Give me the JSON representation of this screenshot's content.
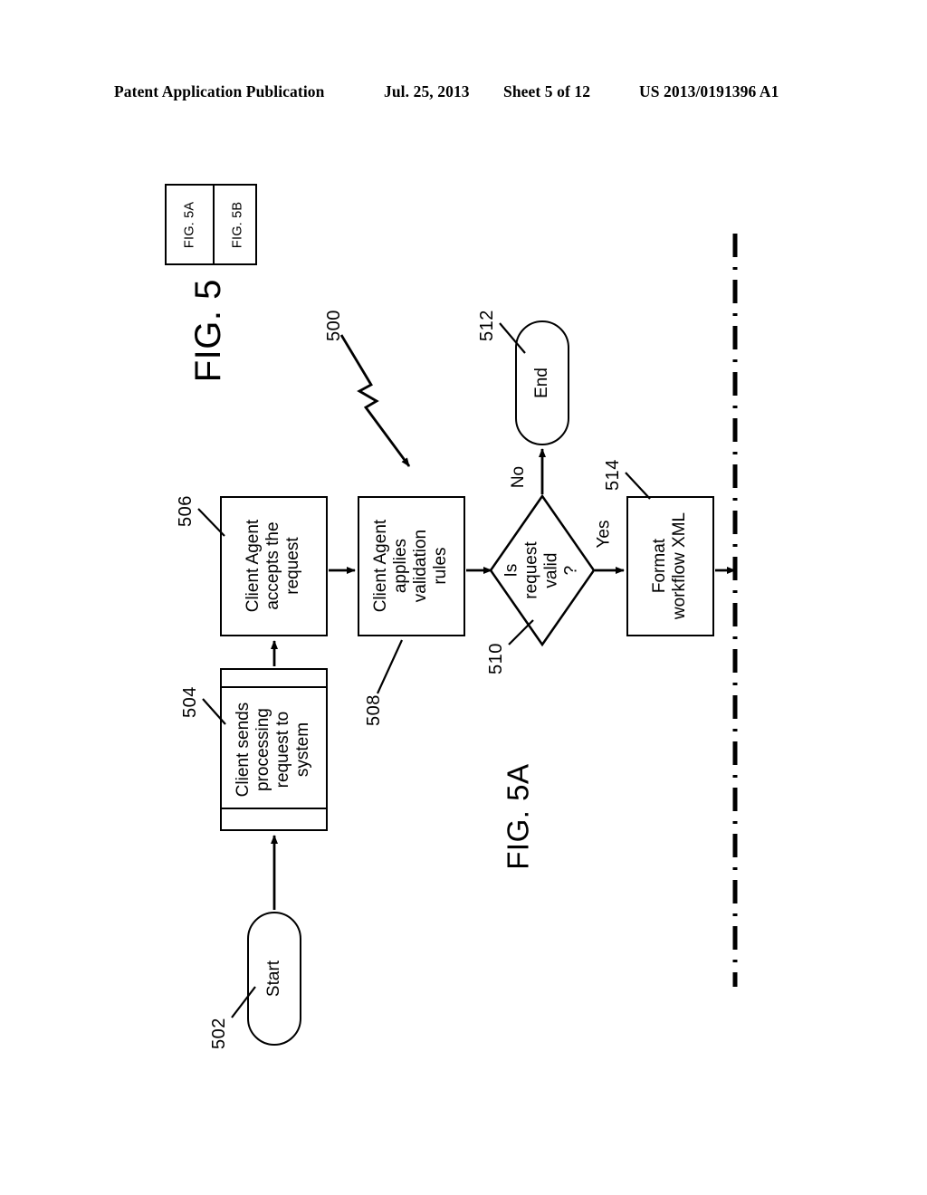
{
  "header": {
    "publication": "Patent Application Publication",
    "date": "Jul. 25, 2013",
    "sheet": "Sheet 5 of 12",
    "patent_number": "US 2013/0191396 A1"
  },
  "index_box": {
    "cells": [
      {
        "label": "FIG. 5A"
      },
      {
        "label": "FIG. 5B"
      }
    ]
  },
  "figure": {
    "title": "FIG. 5",
    "caption": "FIG. 5A",
    "overall_ref": "500"
  },
  "flowchart": {
    "type": "flowchart",
    "orientation": "rotated-90-counterclockwise",
    "nodes": [
      {
        "ref": "502",
        "shape": "terminal",
        "label": "Start"
      },
      {
        "ref": "504",
        "shape": "predefined-process",
        "label": "Client sends\nprocessing\nrequest to\nsystem"
      },
      {
        "ref": "506",
        "shape": "process",
        "label": "Client Agent\naccepts the\nrequest"
      },
      {
        "ref": "508",
        "shape": "process",
        "label": "Client Agent\napplies\nvalidation\nrules"
      },
      {
        "ref": "510",
        "shape": "decision",
        "label": "Is\nrequest\nvalid\n?"
      },
      {
        "ref": "512",
        "shape": "terminal",
        "label": "End"
      },
      {
        "ref": "514",
        "shape": "process",
        "label": "Format\nworkflow XML"
      }
    ],
    "edges": [
      {
        "from": "502",
        "to": "504",
        "label": ""
      },
      {
        "from": "504",
        "to": "506",
        "label": ""
      },
      {
        "from": "506",
        "to": "508",
        "label": ""
      },
      {
        "from": "508",
        "to": "510",
        "label": ""
      },
      {
        "from": "510",
        "to": "512",
        "label": "No"
      },
      {
        "from": "510",
        "to": "514",
        "label": "Yes"
      },
      {
        "from": "514",
        "to": "sheet-boundary",
        "label": ""
      }
    ],
    "branch_labels": {
      "no": "No",
      "yes": "Yes"
    },
    "boundary": {
      "style": "dash-dot",
      "note": "continues on FIG. 5B"
    }
  },
  "colors": {
    "ink": "#000000",
    "paper": "#ffffff"
  }
}
